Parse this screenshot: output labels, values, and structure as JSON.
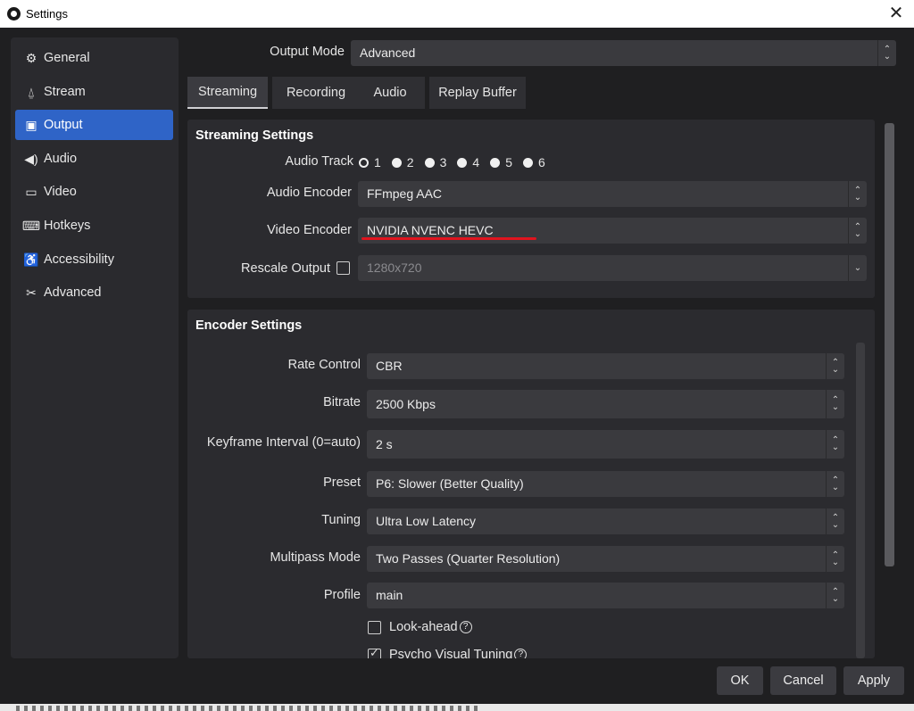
{
  "window": {
    "title": "Settings",
    "close_glyph": "✕"
  },
  "sidebar": {
    "items": [
      {
        "label": "General",
        "icon": "⚙",
        "icon_name": "gear-icon"
      },
      {
        "label": "Stream",
        "icon": "⍙",
        "icon_name": "broadcast-icon"
      },
      {
        "label": "Output",
        "icon": "▣",
        "icon_name": "output-icon"
      },
      {
        "label": "Audio",
        "icon": "◀)",
        "icon_name": "speaker-icon"
      },
      {
        "label": "Video",
        "icon": "▭",
        "icon_name": "monitor-icon"
      },
      {
        "label": "Hotkeys",
        "icon": "⌨",
        "icon_name": "keyboard-icon"
      },
      {
        "label": "Accessibility",
        "icon": "♿",
        "icon_name": "accessibility-icon"
      },
      {
        "label": "Advanced",
        "icon": "✂",
        "icon_name": "tools-icon"
      }
    ],
    "active": "Output"
  },
  "output_mode": {
    "label": "Output Mode",
    "value": "Advanced"
  },
  "tabs": [
    {
      "label": "Streaming"
    },
    {
      "label": "Recording"
    },
    {
      "label": "Audio"
    },
    {
      "label": "Replay Buffer"
    }
  ],
  "streaming_settings": {
    "title": "Streaming Settings",
    "audio_track": {
      "label": "Audio Track",
      "tracks": [
        "1",
        "2",
        "3",
        "4",
        "5",
        "6"
      ],
      "selected": "1"
    },
    "audio_encoder": {
      "label": "Audio Encoder",
      "value": "FFmpeg AAC"
    },
    "video_encoder": {
      "label": "Video Encoder",
      "value": "NVIDIA NVENC HEVC"
    },
    "rescale_output": {
      "label": "Rescale Output",
      "checked": false,
      "value": "1280x720"
    }
  },
  "encoder_settings": {
    "title": "Encoder Settings",
    "rate_control": {
      "label": "Rate Control",
      "value": "CBR"
    },
    "bitrate": {
      "label": "Bitrate",
      "value": "2500 Kbps"
    },
    "keyframe_interval": {
      "label": "Keyframe Interval (0=auto)",
      "value": "2 s"
    },
    "preset": {
      "label": "Preset",
      "value": "P6: Slower (Better Quality)"
    },
    "tuning": {
      "label": "Tuning",
      "value": "Ultra Low Latency"
    },
    "multipass": {
      "label": "Multipass Mode",
      "value": "Two Passes (Quarter Resolution)"
    },
    "profile": {
      "label": "Profile",
      "value": "main"
    },
    "look_ahead": {
      "label": "Look-ahead",
      "checked": false
    },
    "psycho_visual": {
      "label": "Psycho Visual Tuning",
      "checked": true
    }
  },
  "buttons": {
    "ok": "OK",
    "cancel": "Cancel",
    "apply": "Apply"
  },
  "colors": {
    "accent": "#2f64c7",
    "highlight_underline": "#e0141e",
    "background": "#1f1f21",
    "panel": "#2b2b2f"
  }
}
